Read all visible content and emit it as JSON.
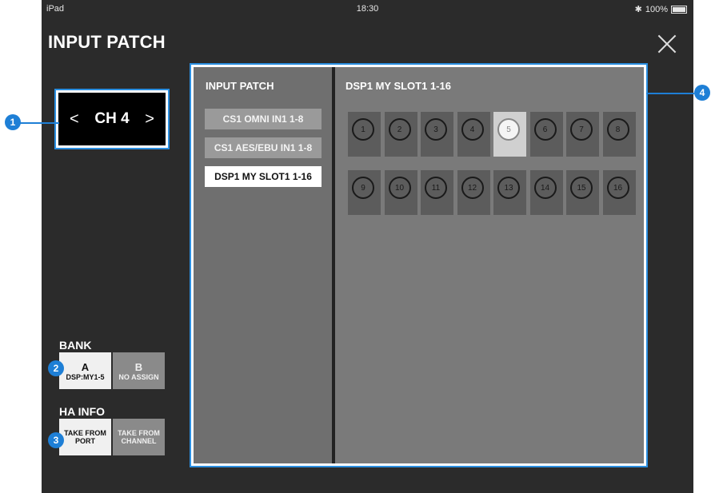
{
  "status": {
    "device": "iPad",
    "time": "18:30",
    "battery": "100%"
  },
  "header": {
    "title": "INPUT PATCH"
  },
  "channel": {
    "prev": "<",
    "label": "CH 4",
    "next": ">"
  },
  "bank": {
    "label": "BANK",
    "a": {
      "letter": "A",
      "sub": "DSP:MY1-5"
    },
    "b": {
      "letter": "B",
      "sub": "NO ASSIGN"
    }
  },
  "ha_info": {
    "label": "HA INFO",
    "port": {
      "line1": "TAKE FROM",
      "line2": "PORT"
    },
    "channel": {
      "line1": "TAKE FROM",
      "line2": "CHANNEL"
    }
  },
  "patch": {
    "heading": "INPUT PATCH",
    "sources": [
      "CS1 OMNI IN1 1-8",
      "CS1 AES/EBU IN1 1-8",
      "DSP1 MY SLOT1 1-16"
    ],
    "selected_source_index": 2,
    "slot_title": "DSP1 MY SLOT1 1-16",
    "ports": [
      "1",
      "2",
      "3",
      "4",
      "5",
      "6",
      "7",
      "8",
      "9",
      "10",
      "11",
      "12",
      "13",
      "14",
      "15",
      "16"
    ],
    "selected_port": "5"
  },
  "callouts": [
    "1",
    "2",
    "3",
    "4"
  ],
  "colors": {
    "accent": "#1e7fd6",
    "panel": "#7a7a7a",
    "background": "#2b2b2b"
  }
}
